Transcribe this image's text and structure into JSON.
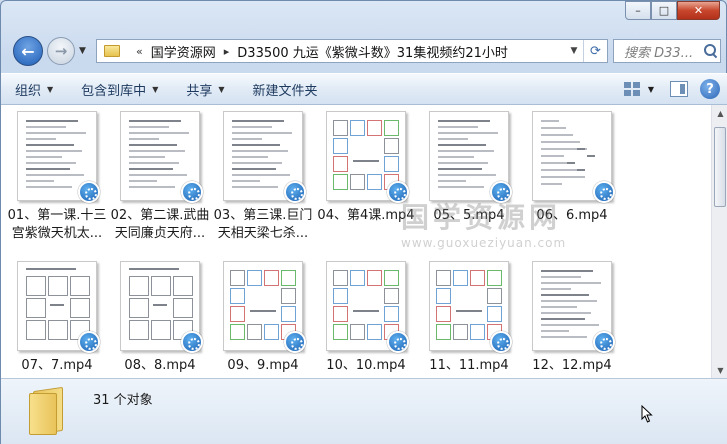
{
  "window": {
    "minimize": "–",
    "maximize": "□",
    "close": "✕"
  },
  "nav": {
    "back": "←",
    "forward": "→",
    "breadcrumb_sep": "«",
    "crumbs": [
      "国学资源网",
      "D33500 九运《紫微斗数》31集视频约21小时"
    ],
    "search_placeholder": "搜索 D33..."
  },
  "toolbar": {
    "organize": "组织",
    "include_library": "包含到库中",
    "share": "共享",
    "new_folder": "新建文件夹"
  },
  "files": [
    {
      "label": "01、第一课.十三宫紫微天机太...",
      "style": "doc"
    },
    {
      "label": "02、第二课.武曲天同廉贞天府...",
      "style": "doc"
    },
    {
      "label": "03、第三课.巨门天相天梁七杀...",
      "style": "doc"
    },
    {
      "label": "04、第4课.mp4",
      "style": "chart"
    },
    {
      "label": "05、5.mp4",
      "style": "doc"
    },
    {
      "label": "06、6.mp4",
      "style": "list"
    },
    {
      "label": "07、7.mp4",
      "style": "grid"
    },
    {
      "label": "08、8.mp4",
      "style": "grid"
    },
    {
      "label": "09、9.mp4",
      "style": "chart"
    },
    {
      "label": "10、10.mp4",
      "style": "chart"
    },
    {
      "label": "11、11.mp4",
      "style": "chart"
    },
    {
      "label": "12、12.mp4",
      "style": "doc"
    }
  ],
  "watermark": {
    "cn": "国学资源网",
    "url": "www.guoxueziyuan.com"
  },
  "status": {
    "count": "31 个对象"
  }
}
